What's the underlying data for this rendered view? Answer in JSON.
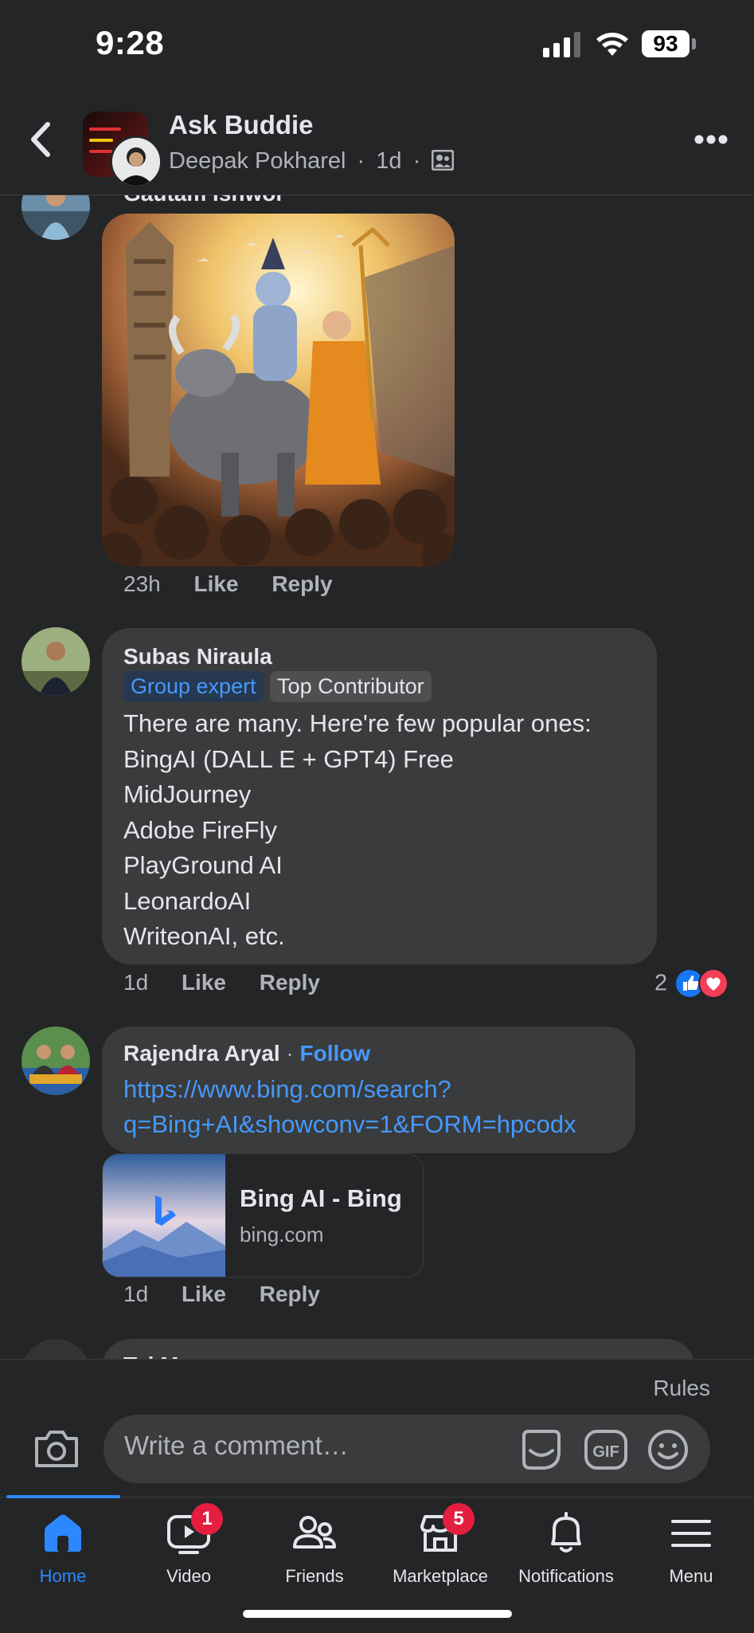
{
  "status_bar": {
    "time": "9:28",
    "battery": "93"
  },
  "header": {
    "title": "Ask Buddie",
    "author": "Deepak Pokharel",
    "separator": "·",
    "age": "1d"
  },
  "comments": [
    {
      "author": "Gautam Ishwor",
      "time": "23h",
      "like_label": "Like",
      "reply_label": "Reply"
    },
    {
      "author": "Subas Niraula",
      "badges": [
        "Group expert",
        "Top Contributor"
      ],
      "lines": [
        "There are many. Here're few popular ones:",
        "BingAI (DALL E + GPT4) Free",
        "MidJourney",
        "Adobe FireFly",
        "PlayGround AI",
        "LeonardoAI",
        "WriteonAI, etc."
      ],
      "time": "1d",
      "like_label": "Like",
      "reply_label": "Reply",
      "reaction_count": "2"
    },
    {
      "author": "Rajendra Aryal",
      "follow_label": "Follow",
      "link_lines": [
        "https://www.bing.com/search?",
        "q=Bing+AI&showconv=1&FORM=hpcodx"
      ],
      "preview": {
        "title": "Bing AI - Bing",
        "domain": "bing.com"
      },
      "time": "1d",
      "like_label": "Like",
      "reply_label": "Reply"
    },
    {
      "author": "Taj M"
    }
  ],
  "composer": {
    "rules_label": "Rules",
    "placeholder": "Write a comment…"
  },
  "tabs": [
    {
      "label": "Home",
      "icon": "home-icon",
      "active": true
    },
    {
      "label": "Video",
      "icon": "video-icon",
      "badge": "1"
    },
    {
      "label": "Friends",
      "icon": "friends-icon"
    },
    {
      "label": "Marketplace",
      "icon": "marketplace-icon",
      "badge": "5"
    },
    {
      "label": "Notifications",
      "icon": "bell-icon"
    },
    {
      "label": "Menu",
      "icon": "menu-icon"
    }
  ],
  "colors": {
    "accent": "#2d88ff",
    "background": "#242526",
    "bubble": "#3a3b3c",
    "badge_red": "#e41e3f"
  }
}
